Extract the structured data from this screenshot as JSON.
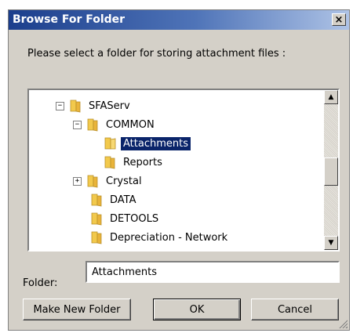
{
  "window": {
    "title": "Browse For Folder",
    "close_glyph": "×"
  },
  "prompt": "Please select a folder for storing attachment files :",
  "tree": {
    "items": [
      {
        "label": "SFAServ",
        "expander": "−",
        "icon": "folder-icon",
        "selected": false
      },
      {
        "label": "COMMON",
        "expander": "−",
        "icon": "folder-icon",
        "selected": false
      },
      {
        "label": "Attachments",
        "expander": "",
        "icon": "folder-open-icon",
        "selected": true
      },
      {
        "label": "Reports",
        "expander": "",
        "icon": "folder-icon",
        "selected": false
      },
      {
        "label": "Crystal",
        "expander": "+",
        "icon": "folder-icon",
        "selected": false
      },
      {
        "label": "DATA",
        "expander": "",
        "icon": "folder-icon",
        "selected": false
      },
      {
        "label": "DETOOLS",
        "expander": "",
        "icon": "folder-icon",
        "selected": false
      },
      {
        "label": "Depreciation - Network",
        "expander": "",
        "icon": "folder-icon",
        "selected": false
      }
    ],
    "scroll_up_glyph": "▲",
    "scroll_down_glyph": "▼"
  },
  "folder_field": {
    "label": "Folder:",
    "value": "Attachments"
  },
  "buttons": {
    "make_new_folder": "Make New Folder",
    "ok": "OK",
    "cancel": "Cancel"
  },
  "colors": {
    "selection": "#0a246a",
    "folder_yellow": "#f2c94c",
    "dialog_bg": "#d4d0c8"
  }
}
